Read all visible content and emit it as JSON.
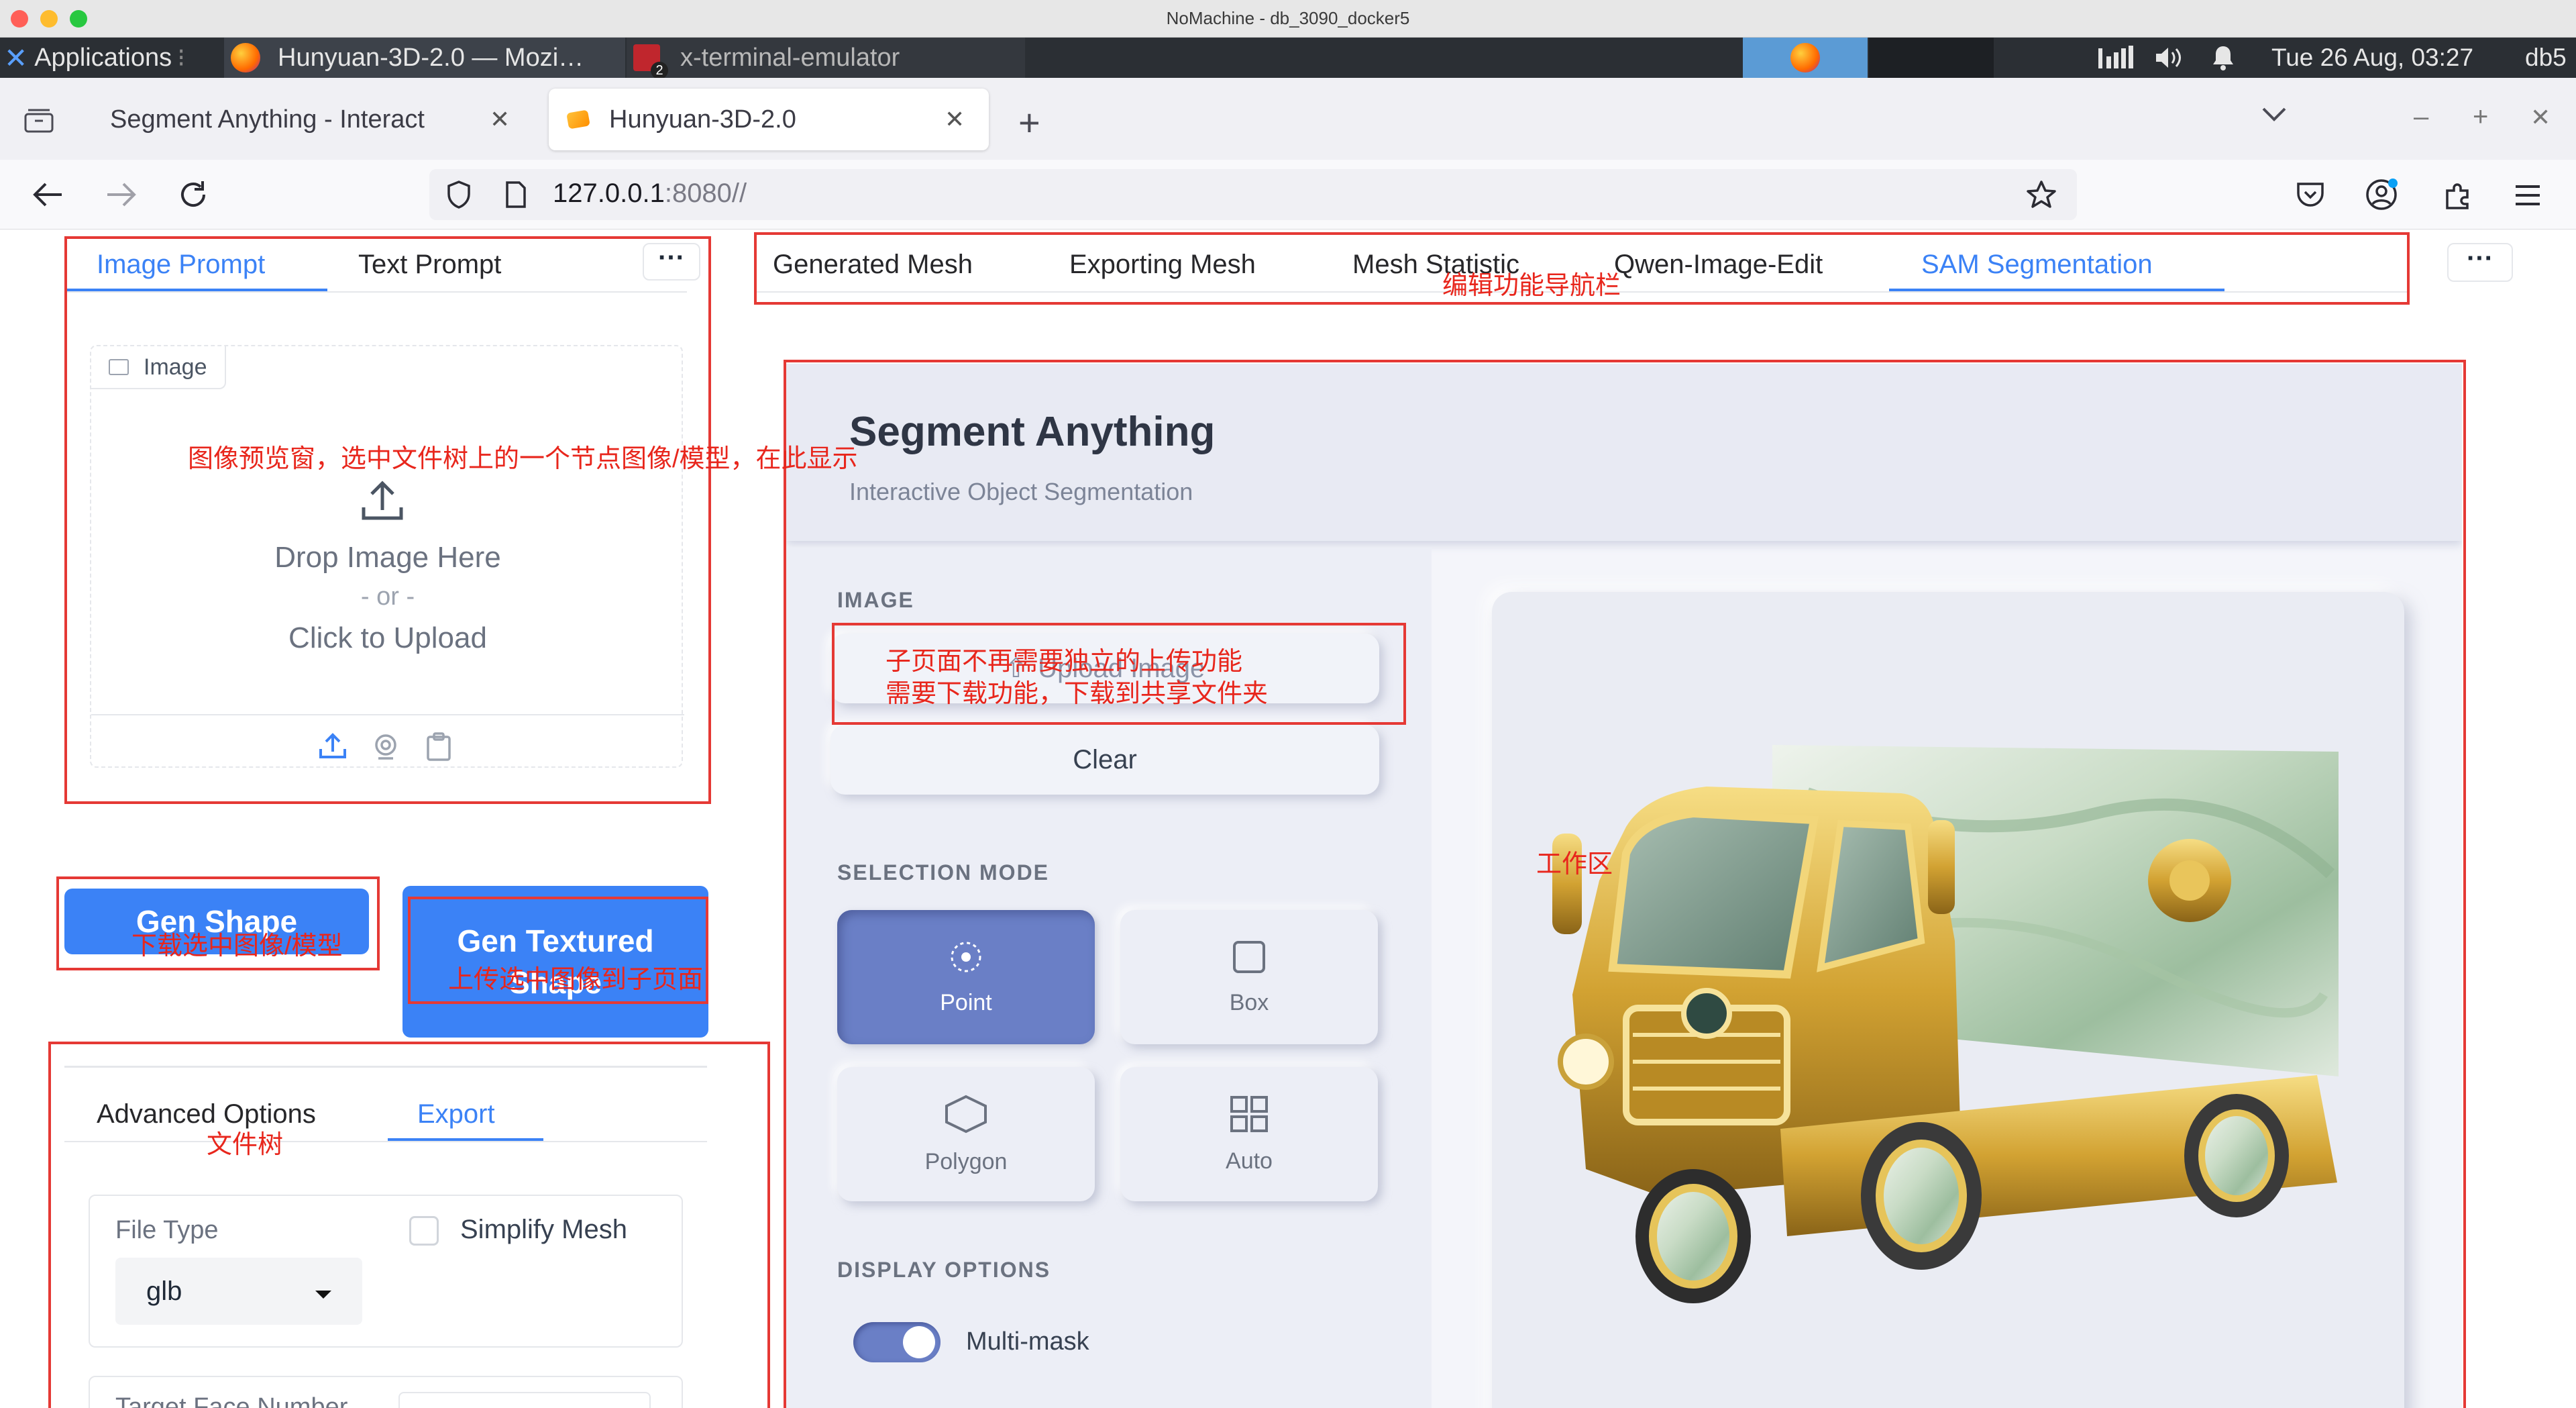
{
  "window": {
    "title": "NoMachine - db_3090_docker5"
  },
  "taskbar": {
    "apps_label": "Applications",
    "window_buttons": [
      "Hunyuan-3D-2.0 — Mozi…",
      "x-terminal-emulator"
    ],
    "terminal_badge": "2",
    "clock": "Tue 26 Aug, 03:27",
    "user": "db5"
  },
  "browser": {
    "tabs": [
      {
        "label": "Segment Anything - Interact"
      },
      {
        "label": "Hunyuan-3D-2.0"
      }
    ],
    "url_host": "127.0.0.1",
    "url_rest": ":8080//"
  },
  "left_panel": {
    "prompt_tabs": [
      "Image Prompt",
      "Text Prompt"
    ],
    "image_label": "Image",
    "drop_text": "Drop Image Here",
    "or_text": "- or -",
    "click_text": "Click to Upload",
    "gen_shape": "Gen Shape",
    "gen_textured": "Gen Textured Shape",
    "option_tabs": [
      "Advanced Options",
      "Export"
    ],
    "file_type_label": "File Type",
    "file_type_value": "glb",
    "simplify_label": "Simplify Mesh",
    "target_face_label": "Target Face Number"
  },
  "main_tabs": [
    "Generated Mesh",
    "Exporting Mesh",
    "Mesh Statistic",
    "Qwen-Image-Edit",
    "SAM Segmentation"
  ],
  "sam": {
    "title": "Segment Anything",
    "subtitle": "Interactive Object Segmentation",
    "image_section": "IMAGE",
    "upload_label": "Upload Image",
    "clear_label": "Clear",
    "selection_section": "SELECTION MODE",
    "modes": [
      "Point",
      "Box",
      "Polygon",
      "Auto"
    ],
    "display_section": "DISPLAY OPTIONS",
    "multimask_label": "Multi-mask"
  },
  "annotations": {
    "preview": "图像预览窗，选中文件树上的一个节点图像/模型，在此显示",
    "nav": "编辑功能导航栏",
    "upload_line1": "子页面不再需要独立的上传功能",
    "upload_line2": "需要下载功能，下载到共享文件夹",
    "download": "下载选中图像/模型",
    "upload_to_sub": "上传选中图像到子页面",
    "file_tree": "文件树",
    "workspace": "工作区"
  },
  "colors": {
    "accent": "#3b82f6",
    "annotation_red": "#e53935",
    "point_active": "#6a7fc6",
    "panel_bg": "#2b2f34"
  }
}
